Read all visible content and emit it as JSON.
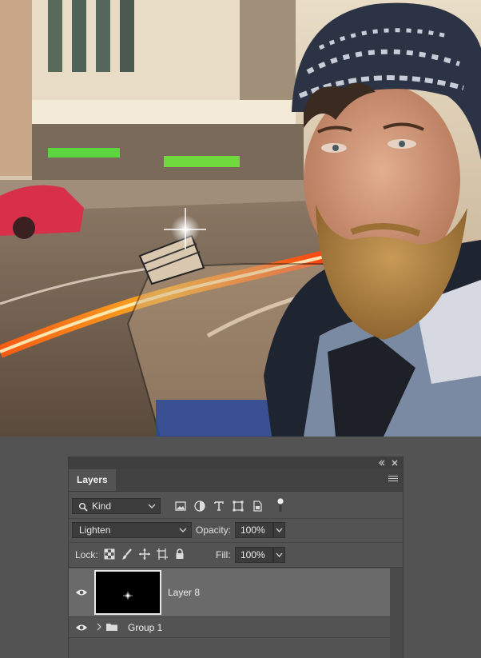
{
  "panel": {
    "tab_label": "Layers",
    "collapse_icon": "double-chevron-icon",
    "close_icon": "close-icon",
    "menu_icon": "panel-menu-icon"
  },
  "filter": {
    "kind_label": "Kind",
    "icons": [
      "image-filter-icon",
      "adjustment-filter-icon",
      "type-filter-icon",
      "shape-filter-icon",
      "smart-object-filter-icon",
      "filter-toggle-icon"
    ]
  },
  "blend": {
    "mode": "Lighten",
    "opacity_label": "Opacity:",
    "opacity_value": "100%"
  },
  "lock": {
    "label": "Lock:",
    "icons": [
      "lock-transparency-icon",
      "lock-image-icon",
      "lock-position-icon",
      "lock-artboard-icon",
      "lock-all-icon"
    ],
    "fill_label": "Fill:",
    "fill_value": "100%"
  },
  "layers": [
    {
      "name": "Layer 8",
      "visible": true,
      "selected": true,
      "type": "layer"
    },
    {
      "name": "Group 1",
      "visible": true,
      "selected": false,
      "type": "group"
    }
  ],
  "colors": {
    "panel_bg": "#535353",
    "selected_row": "#6a6a6a",
    "field_bg": "#3c3c3c"
  }
}
